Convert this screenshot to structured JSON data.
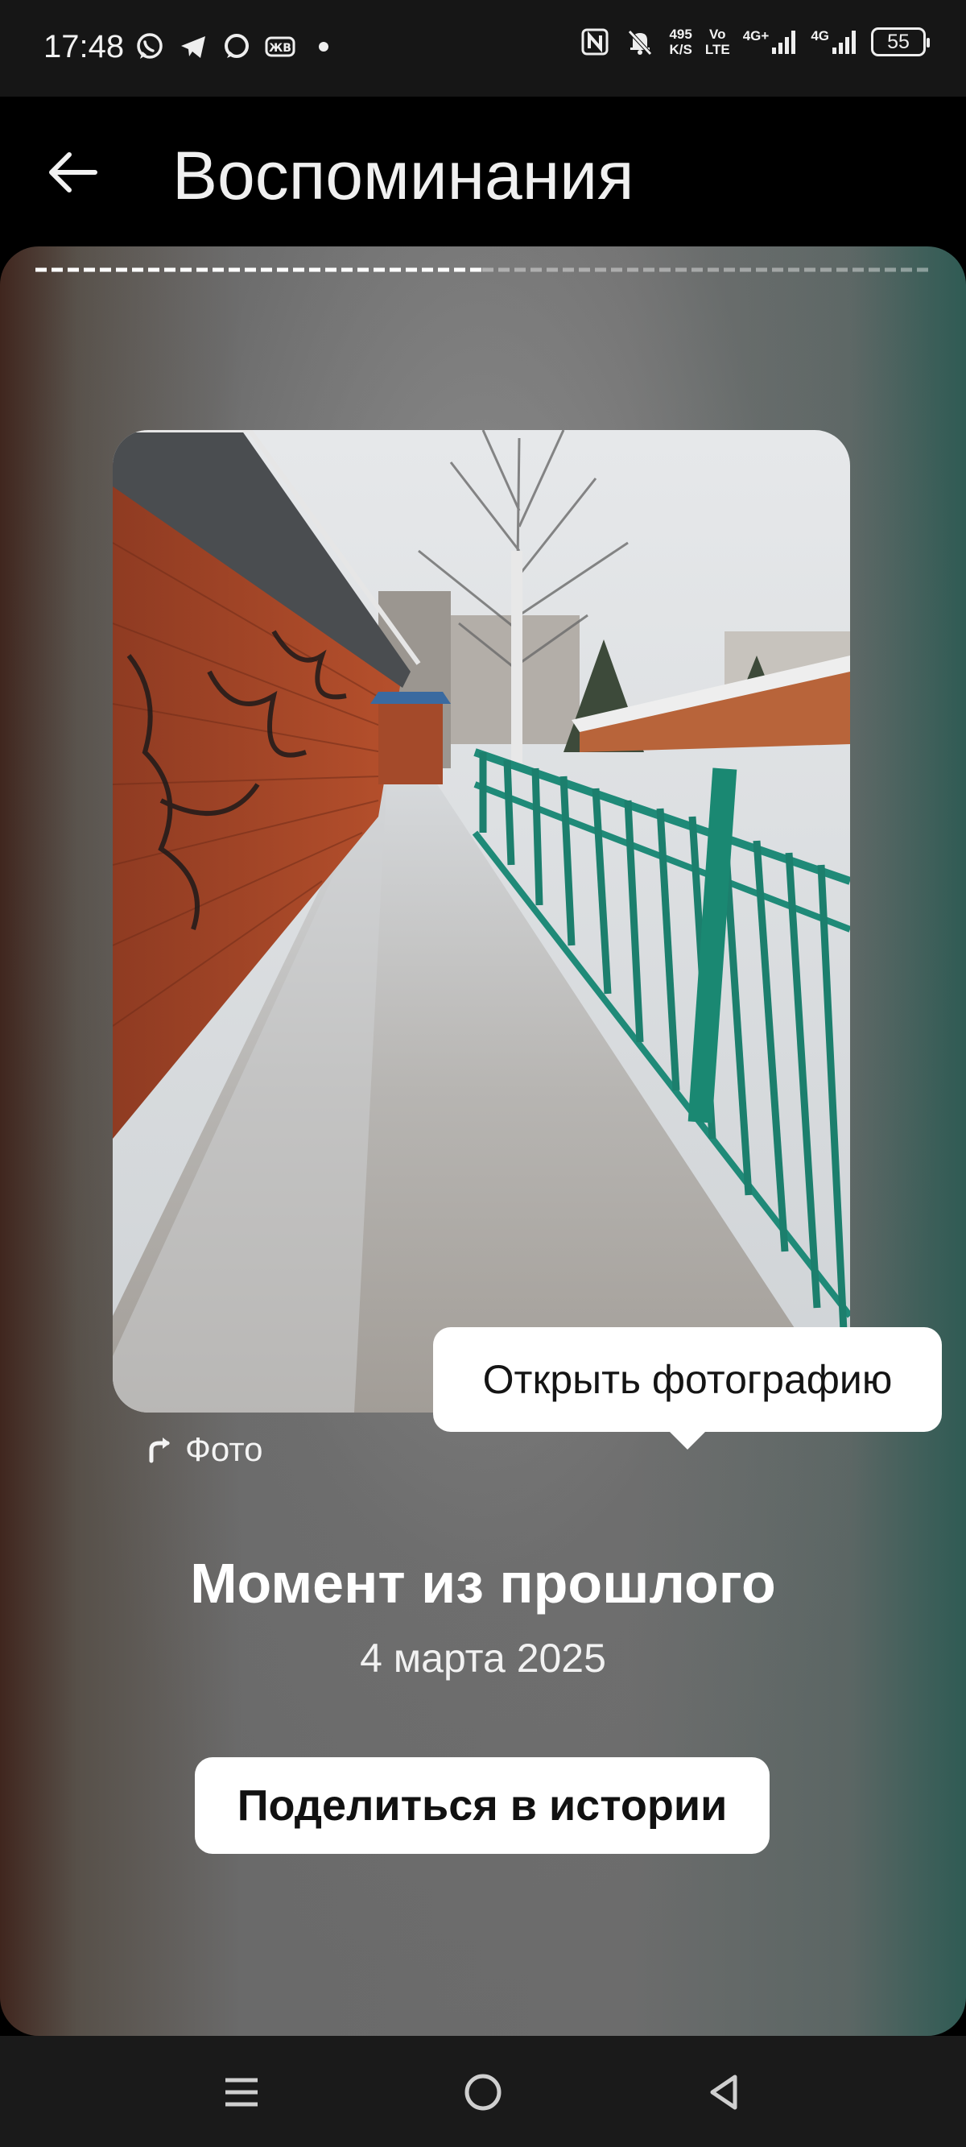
{
  "status_bar": {
    "time": "17:48",
    "left_icons": [
      "whatsapp-icon",
      "telegram-icon",
      "chat-bubble-icon",
      "vk-icon",
      "dot-icon"
    ],
    "right_icons": [
      "nfc-icon",
      "bell-muted-icon",
      "signal-icon",
      "signal-icon"
    ],
    "net_speed_value": "495",
    "net_speed_unit": "K/S",
    "volte_top": "Vo",
    "volte_bottom": "LTE",
    "net_type_1": "4G+",
    "net_type_2": "4G",
    "battery": "55"
  },
  "app_bar": {
    "back_icon": "arrow-left-icon",
    "title": "Воспоминания"
  },
  "story": {
    "progress_fraction": 0.5,
    "tooltip": "Открыть фотографию",
    "source_icon": "share-arrow-icon",
    "source_label": "Фото",
    "title": "Момент из прошлого",
    "date": "4 марта 2025",
    "share_button": "Поделиться в истории"
  },
  "nav_bar": {
    "items": [
      "menu-icon",
      "home-circle-icon",
      "back-triangle-icon"
    ]
  }
}
